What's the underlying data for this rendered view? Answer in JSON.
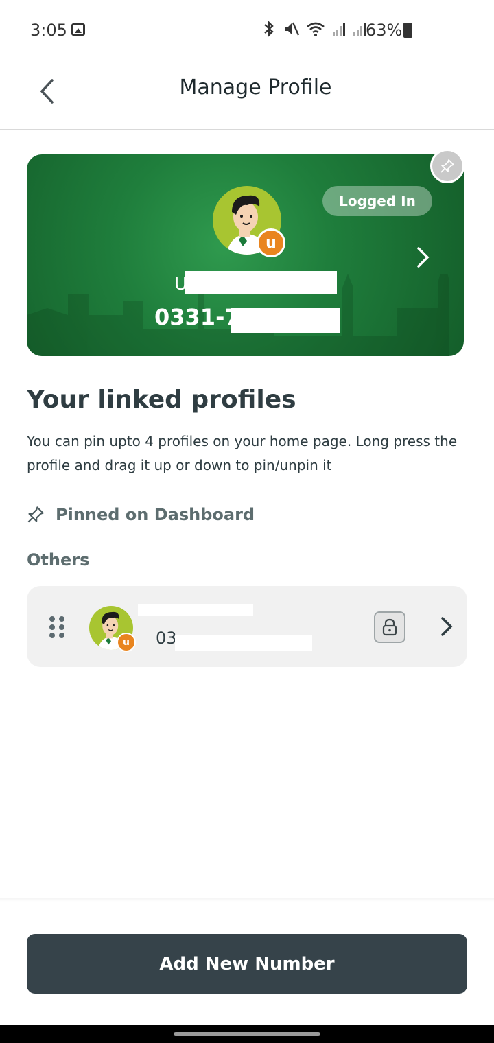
{
  "status_bar": {
    "time": "3:05",
    "battery": "63%",
    "icons": [
      "image-icon",
      "bluetooth-icon",
      "mute-icon",
      "wifi-icon",
      "signal-icon",
      "signal-icon",
      "battery-icon"
    ]
  },
  "header": {
    "title": "Manage Profile",
    "back_icon": "chevron-left-icon"
  },
  "profile_card": {
    "status_badge": "Logged In",
    "name_visible": "U",
    "number_visible": "0331-7",
    "badge_letter": "u",
    "pin_icon": "pin-icon",
    "chevron_icon": "chevron-right-icon"
  },
  "linked": {
    "title": "Your linked profiles",
    "description": "You can pin upto 4 profiles on your home page. Long press the profile and drag it up or down to pin/unpin it",
    "pinned_label": "Pinned on Dashboard",
    "others_label": "Others",
    "items": [
      {
        "number_visible": "03",
        "badge_letter": "u",
        "lock_icon": "lock-icon",
        "drag_icon": "drag-handle-icon",
        "chevron_icon": "chevron-right-icon"
      }
    ]
  },
  "footer": {
    "add_button": "Add New Number"
  },
  "colors": {
    "card_green": "#1f7e3c",
    "badge_orange": "#e9851f",
    "avatar_green": "#a8c531",
    "button_dark": "#36434a",
    "text_dark": "#2f3d42",
    "text_muted": "#5d6d6f"
  }
}
